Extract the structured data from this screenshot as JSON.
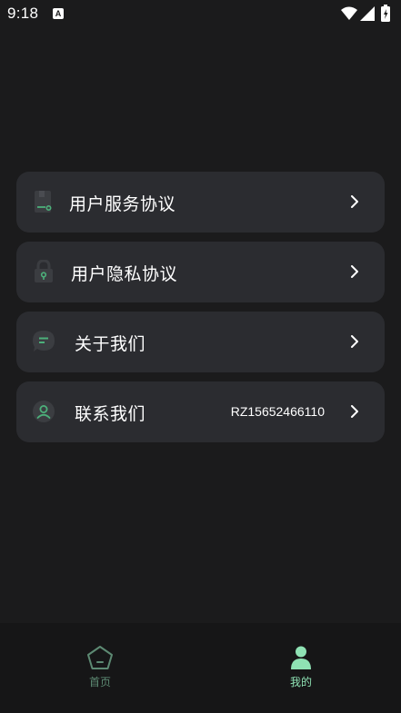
{
  "status_bar": {
    "time": "9:18",
    "notification_badge": "A"
  },
  "menu": [
    {
      "label": "用户服务协议",
      "value": "",
      "icon": "document-icon"
    },
    {
      "label": "用户隐私协议",
      "value": "",
      "icon": "lock-icon"
    },
    {
      "label": "关于我们",
      "value": "",
      "icon": "chat-bubble-icon"
    },
    {
      "label": "联系我们",
      "value": "RZ15652466110",
      "icon": "user-icon"
    }
  ],
  "bottom_nav": [
    {
      "label": "首页",
      "icon": "home-pentagon-icon",
      "active": false
    },
    {
      "label": "我的",
      "icon": "person-icon",
      "active": true
    }
  ],
  "colors": {
    "background": "#1b1b1c",
    "card": "#2b2c30",
    "accent": "#4caf7a",
    "nav_active": "#8fe2b4",
    "nav_inactive": "#5d8a73"
  }
}
